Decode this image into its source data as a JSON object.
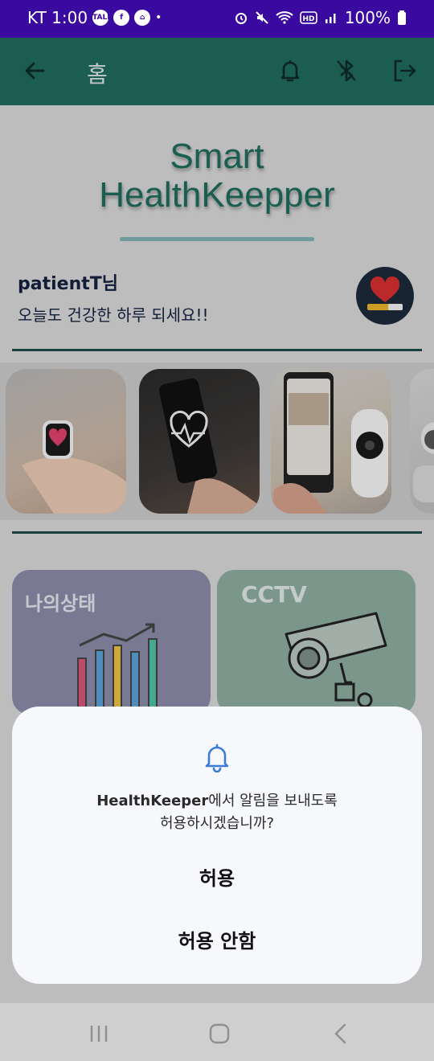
{
  "status_bar": {
    "carrier_time": "KT 1:00",
    "notif_icons": [
      "talk-icon",
      "facebook-icon",
      "messenger-icon"
    ],
    "dot": "•",
    "battery": "100%"
  },
  "app_bar": {
    "title": "홈"
  },
  "brand": {
    "line1": "Smart",
    "line2": "HealthKeepper"
  },
  "greeting": {
    "name": "patientT님",
    "message": "오늘도 건강한 하루 되세요!!"
  },
  "carousel": [
    "smartwatch-photo",
    "phone-heart-photo",
    "cctv-app-photo",
    "security-camera-photo"
  ],
  "tiles": {
    "status_label": "나의상태",
    "cctv_label": "CCTV"
  },
  "dialog": {
    "app_name": "HealthKeeper",
    "message_suffix": "에서 알림을 보내도록",
    "message_line2": "허용하시겠습니까?",
    "allow_label": "허용",
    "deny_label": "허용 안함"
  },
  "colors": {
    "status_bar": "#3a0aa0",
    "app_bar": "#1f6b5d",
    "brand_text": "#1d6c5c",
    "dialog_accent": "#3d7bd9"
  }
}
